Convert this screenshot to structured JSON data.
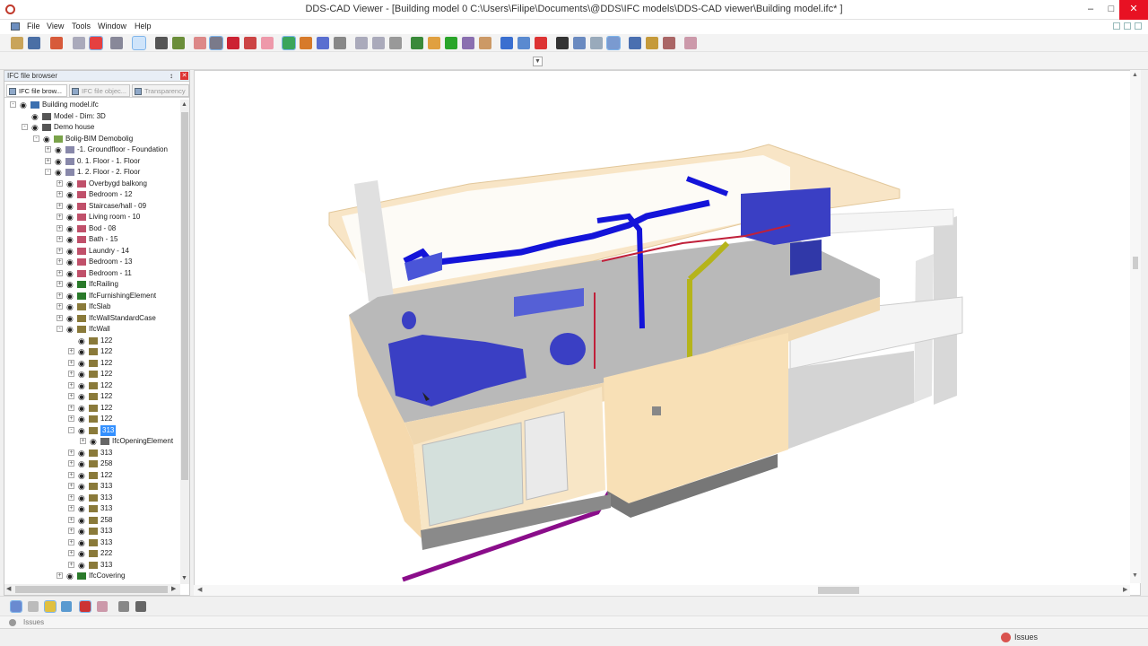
{
  "window": {
    "title": "DDS-CAD Viewer - [Building model  0  C:\\Users\\Filipe\\Documents\\@DDS\\IFC models\\DDS-CAD viewer\\Building model.ifc* ]",
    "minimize": "–",
    "maximize": "□",
    "close": "✕"
  },
  "menu": [
    "File",
    "View",
    "Tools",
    "Window",
    "Help"
  ],
  "panel": {
    "title": "IFC file browser",
    "pin": "↕",
    "close": "✕",
    "tabs": [
      "IFC file brow...",
      "IFC file objec...",
      "Transparency"
    ]
  },
  "tree": [
    {
      "depth": 0,
      "label": "Building model.ifc",
      "exp": "-",
      "icon": "ifc-file"
    },
    {
      "depth": 1,
      "label": "Model - Dim: 3D",
      "exp": "",
      "icon": "model"
    },
    {
      "depth": 1,
      "label": "Demo house",
      "exp": "-",
      "icon": "site"
    },
    {
      "depth": 2,
      "label": "Bolig-BIM Demobolig",
      "exp": "-",
      "icon": "building"
    },
    {
      "depth": 3,
      "label": "-1. Groundfloor - Foundation",
      "exp": "+",
      "icon": "storey"
    },
    {
      "depth": 3,
      "label": "0. 1. Floor - 1. Floor",
      "exp": "+",
      "icon": "storey"
    },
    {
      "depth": 3,
      "label": "1. 2. Floor - 2. Floor",
      "exp": "-",
      "icon": "storey"
    },
    {
      "depth": 4,
      "label": "Overbygd balkong",
      "exp": "+",
      "icon": "space"
    },
    {
      "depth": 4,
      "label": "Bedroom - 12",
      "exp": "+",
      "icon": "space"
    },
    {
      "depth": 4,
      "label": "Staircase/hall - 09",
      "exp": "+",
      "icon": "space"
    },
    {
      "depth": 4,
      "label": "Living room - 10",
      "exp": "+",
      "icon": "space"
    },
    {
      "depth": 4,
      "label": "Bod - 08",
      "exp": "+",
      "icon": "space"
    },
    {
      "depth": 4,
      "label": "Bath - 15",
      "exp": "+",
      "icon": "space"
    },
    {
      "depth": 4,
      "label": "Laundry - 14",
      "exp": "+",
      "icon": "space"
    },
    {
      "depth": 4,
      "label": "Bedroom - 13",
      "exp": "+",
      "icon": "space"
    },
    {
      "depth": 4,
      "label": "Bedroom - 11",
      "exp": "+",
      "icon": "space"
    },
    {
      "depth": 4,
      "label": "IfcRailing",
      "exp": "+",
      "icon": "ifc"
    },
    {
      "depth": 4,
      "label": "IfcFurnishingElement",
      "exp": "+",
      "icon": "ifc"
    },
    {
      "depth": 4,
      "label": "IfcSlab",
      "exp": "+",
      "icon": "folder"
    },
    {
      "depth": 4,
      "label": "IfcWallStandardCase",
      "exp": "+",
      "icon": "folder"
    },
    {
      "depth": 4,
      "label": "IfcWall",
      "exp": "-",
      "icon": "folder"
    },
    {
      "depth": 5,
      "label": "122",
      "exp": "",
      "icon": "folder"
    },
    {
      "depth": 5,
      "label": "122",
      "exp": "+",
      "icon": "folder"
    },
    {
      "depth": 5,
      "label": "122",
      "exp": "+",
      "icon": "folder"
    },
    {
      "depth": 5,
      "label": "122",
      "exp": "+",
      "icon": "folder"
    },
    {
      "depth": 5,
      "label": "122",
      "exp": "+",
      "icon": "folder"
    },
    {
      "depth": 5,
      "label": "122",
      "exp": "+",
      "icon": "folder"
    },
    {
      "depth": 5,
      "label": "122",
      "exp": "+",
      "icon": "folder"
    },
    {
      "depth": 5,
      "label": "122",
      "exp": "+",
      "icon": "folder"
    },
    {
      "depth": 5,
      "label": "313",
      "exp": "-",
      "icon": "folder",
      "selected": true
    },
    {
      "depth": 6,
      "label": "IfcOpeningElement",
      "exp": "+",
      "icon": "box"
    },
    {
      "depth": 5,
      "label": "313",
      "exp": "+",
      "icon": "folder"
    },
    {
      "depth": 5,
      "label": "258",
      "exp": "+",
      "icon": "folder"
    },
    {
      "depth": 5,
      "label": "122",
      "exp": "+",
      "icon": "folder"
    },
    {
      "depth": 5,
      "label": "313",
      "exp": "+",
      "icon": "folder"
    },
    {
      "depth": 5,
      "label": "313",
      "exp": "+",
      "icon": "folder"
    },
    {
      "depth": 5,
      "label": "313",
      "exp": "+",
      "icon": "folder"
    },
    {
      "depth": 5,
      "label": "258",
      "exp": "+",
      "icon": "folder"
    },
    {
      "depth": 5,
      "label": "313",
      "exp": "+",
      "icon": "folder"
    },
    {
      "depth": 5,
      "label": "313",
      "exp": "+",
      "icon": "folder"
    },
    {
      "depth": 5,
      "label": "222",
      "exp": "+",
      "icon": "folder"
    },
    {
      "depth": 5,
      "label": "313",
      "exp": "+",
      "icon": "folder"
    },
    {
      "depth": 4,
      "label": "IfcCovering",
      "exp": "+",
      "icon": "ifc"
    }
  ],
  "issues_tab": "Issues",
  "status_issues": "Issues",
  "colors": {
    "wall": "#f7e1bc",
    "duct_blue": "#1414d9",
    "pipe_magenta": "#8a0d8a",
    "pipe_yellow": "#b5b41a",
    "furniture": "#3a3fc4",
    "floor": "#b7b7b7",
    "selection": "#3390ff"
  }
}
